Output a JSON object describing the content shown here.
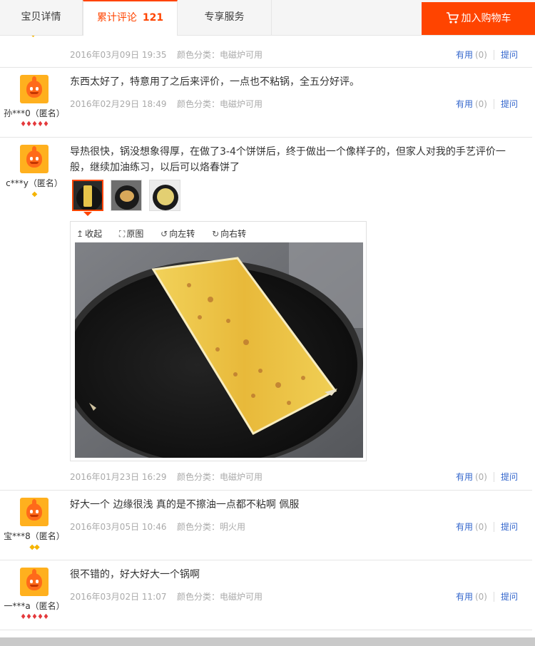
{
  "tabs": {
    "details": "宝贝详情",
    "reviews": "累计评论",
    "reviews_count": "121",
    "service": "专享服务",
    "cart": "加入购物车"
  },
  "colors": {
    "accent": "#ff4400",
    "link": "#3366cc"
  },
  "reviews": [
    {
      "date": "2016年03月09日 19:35",
      "spec": "颜色分类：电磁炉可用",
      "useful": "有用",
      "useful_count": "(0)",
      "reply": "提问"
    },
    {
      "nick": "孙***0（匿名）",
      "rank": "♦♦♦♦♦",
      "text": "东西太好了，特意用了之后来评价，一点也不粘锅，全五分好评。",
      "date": "2016年02月29日 18:49",
      "spec": "颜色分类：电磁炉可用",
      "useful": "有用",
      "useful_count": "(0)",
      "reply": "提问"
    },
    {
      "nick": "c***y（匿名）",
      "rank": "◆",
      "text": "导热很快，锅没想象得厚，在做了3-4个饼饼后，终于做出一个像样子的，但家人对我的手艺评价一般，继续加油练习，以后可以烙春饼了",
      "viewer": {
        "collapse": "收起",
        "original": "原图",
        "rotate_left": "向左转",
        "rotate_right": "向右转"
      },
      "date": "2016年01月23日 16:29",
      "spec": "颜色分类：电磁炉可用",
      "useful": "有用",
      "useful_count": "(0)",
      "reply": "提问"
    },
    {
      "nick": "宝***8（匿名）",
      "rank": "◆◆",
      "text": "好大一个 边缘很浅 真的是不擦油一点都不粘啊 佩服",
      "date": "2016年03月05日 10:46",
      "spec": "颜色分类：明火用",
      "useful": "有用",
      "useful_count": "(0)",
      "reply": "提问"
    },
    {
      "nick": "一***a（匿名）",
      "rank": "♦♦♦♦♦",
      "text": "很不错的，好大好大一个锅啊",
      "date": "2016年03月02日 11:07",
      "spec": "颜色分类：电磁炉可用",
      "useful": "有用",
      "useful_count": "(0)",
      "reply": "提问"
    }
  ]
}
